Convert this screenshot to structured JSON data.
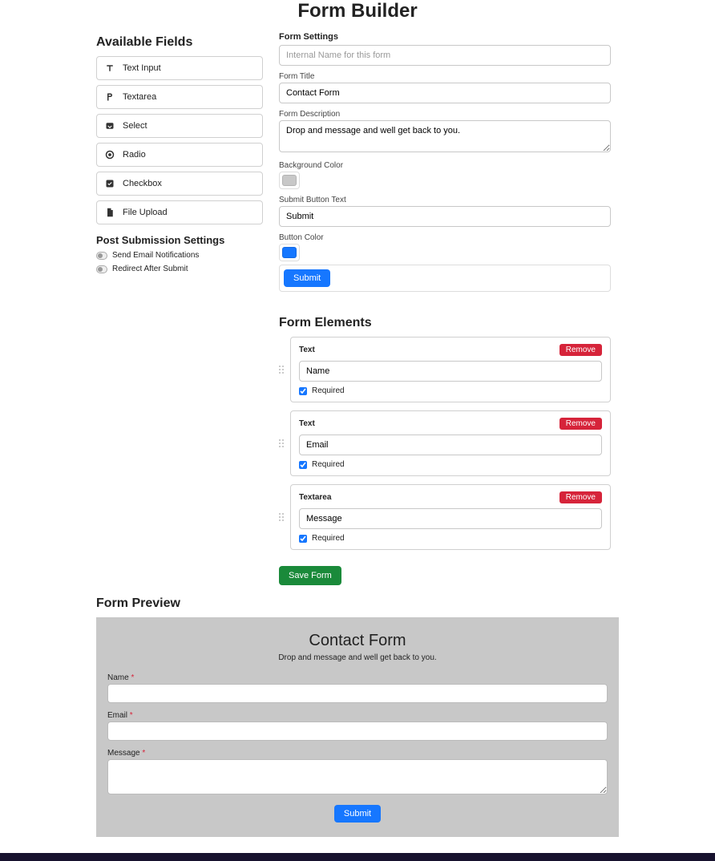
{
  "page": {
    "title": "Form Builder"
  },
  "available_fields": {
    "heading": "Available Fields",
    "items": [
      {
        "icon": "text-icon",
        "label": "Text Input"
      },
      {
        "icon": "textarea-icon",
        "label": "Textarea"
      },
      {
        "icon": "select-icon",
        "label": "Select"
      },
      {
        "icon": "radio-icon",
        "label": "Radio"
      },
      {
        "icon": "checkbox-icon",
        "label": "Checkbox"
      },
      {
        "icon": "file-icon",
        "label": "File Upload"
      }
    ]
  },
  "post_submission": {
    "heading": "Post Submission Settings",
    "items": [
      {
        "label": "Send Email Notifications",
        "enabled": false
      },
      {
        "label": "Redirect After Submit",
        "enabled": false
      }
    ]
  },
  "form_settings": {
    "heading": "Form Settings",
    "internal_name_placeholder": "Internal Name for this form",
    "internal_name_value": "",
    "title_label": "Form Title",
    "title_value": "Contact Form",
    "description_label": "Form Description",
    "description_value": "Drop and message and well get back to you.",
    "bg_color_label": "Background Color",
    "bg_color_value": "#c8c8c8",
    "submit_text_label": "Submit Button Text",
    "submit_text_value": "Submit",
    "button_color_label": "Button Color",
    "button_color_value": "#1677ff",
    "submit_preview_label": "Submit"
  },
  "form_elements": {
    "heading": "Form Elements",
    "remove_label": "Remove",
    "required_label": "Required",
    "items": [
      {
        "type": "Text",
        "name": "Name",
        "required": true
      },
      {
        "type": "Text",
        "name": "Email",
        "required": true
      },
      {
        "type": "Textarea",
        "name": "Message",
        "required": true
      }
    ],
    "save_label": "Save Form"
  },
  "form_preview": {
    "heading": "Form Preview",
    "title": "Contact Form",
    "description": "Drop and message and well get back to you.",
    "required_mark": "*",
    "fields": [
      {
        "label": "Name",
        "type": "text"
      },
      {
        "label": "Email",
        "type": "text"
      },
      {
        "label": "Message",
        "type": "textarea"
      }
    ],
    "submit_label": "Submit"
  }
}
